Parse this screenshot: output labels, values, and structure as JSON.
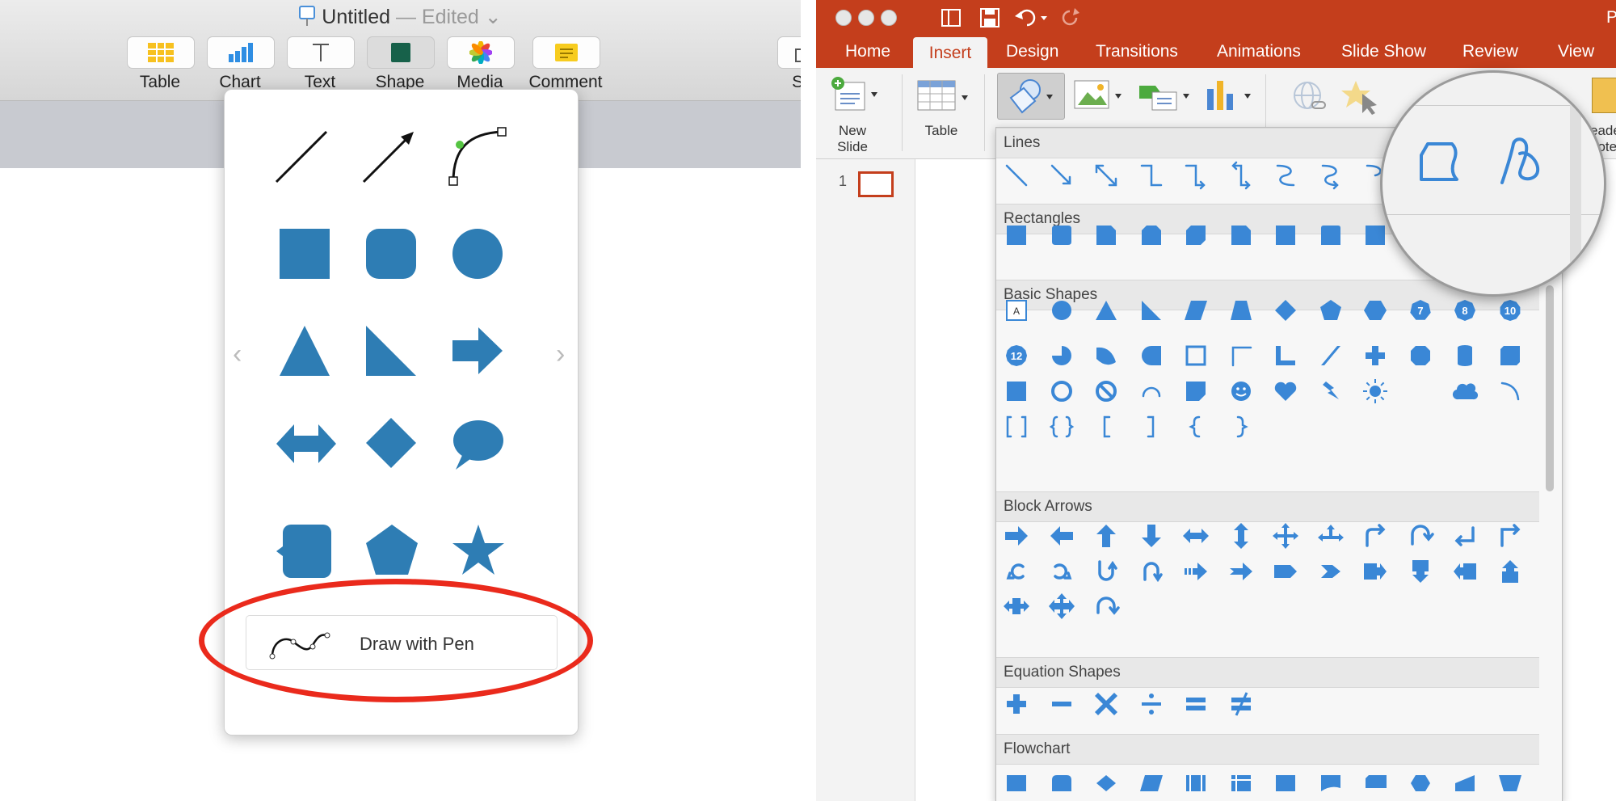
{
  "keynote": {
    "title": "Untitled",
    "title_status": "— Edited",
    "tools": [
      {
        "label": "Table",
        "icon": "table-icon"
      },
      {
        "label": "Chart",
        "icon": "chart-icon"
      },
      {
        "label": "Text",
        "icon": "text-icon"
      },
      {
        "label": "Shape",
        "icon": "shape-icon"
      },
      {
        "label": "Media",
        "icon": "media-icon"
      },
      {
        "label": "Comment",
        "icon": "comment-icon"
      },
      {
        "label": "Sh",
        "icon": "share-icon"
      }
    ],
    "shapes_popover": {
      "pen_label": "Draw with Pen",
      "shape_color": "#2e7db4"
    },
    "highlight_color": "#ea2a1c"
  },
  "powerpoint": {
    "accent_color": "#c43e1c",
    "title_partial": "P",
    "tabs": [
      "Home",
      "Insert",
      "Design",
      "Transitions",
      "Animations",
      "Slide Show",
      "Review",
      "View"
    ],
    "active_tab": "Insert",
    "ribbon": {
      "new_slide_label_1": "New",
      "new_slide_label_2": "Slide",
      "table_label": "Table",
      "header_partial_1": "eade",
      "header_partial_2": "oote"
    },
    "slide_number": "1",
    "shapes_menu": {
      "categories": [
        "Lines",
        "Rectangles",
        "Basic Shapes",
        "Block Arrows",
        "Equation Shapes",
        "Flowchart"
      ],
      "badge_numbers": [
        "7",
        "8",
        "10",
        "12"
      ],
      "shape_color": "#3a87d6",
      "magnified_shapes": [
        "freeform-icon",
        "scribble-icon"
      ]
    }
  }
}
